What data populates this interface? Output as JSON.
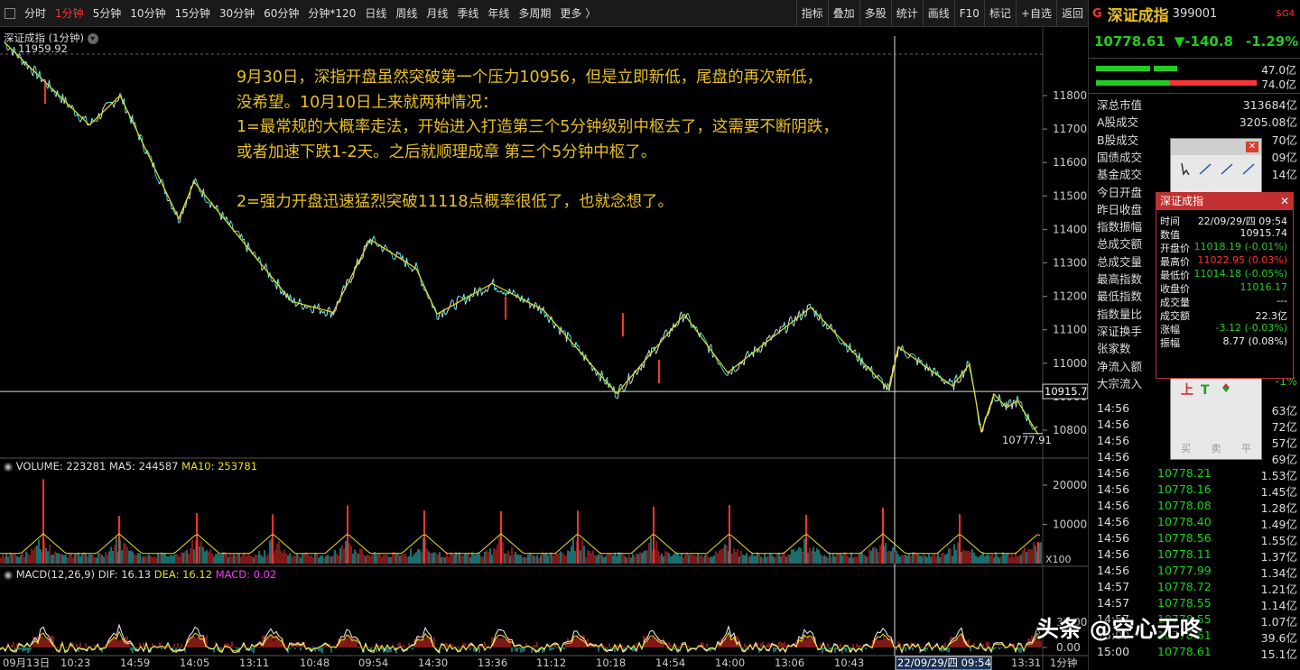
{
  "toolbar": {
    "left": [
      "分时",
      "1分钟",
      "5分钟",
      "10分钟",
      "15分钟",
      "30分钟",
      "60分钟",
      "分钟*120",
      "日线",
      "周线",
      "月线",
      "季线",
      "年线",
      "多周期",
      "更多 〉"
    ],
    "active_index": 1,
    "right": [
      "指标",
      "叠加",
      "多股",
      "统计",
      "画线",
      "F10",
      "标记",
      "+自选",
      "返回"
    ]
  },
  "chart": {
    "title": "深证成指 (1分钟)",
    "high_label": "11959.92",
    "low_label": "10777.91",
    "cursor_value": "10915.7",
    "price_ticks": [
      "11800",
      "11700",
      "11600",
      "11500",
      "11400",
      "11300",
      "11200",
      "11100",
      "11000",
      "10900",
      "10800"
    ],
    "annotation": "9月30日，深指开盘虽然突破第一个压力10956，但是立即新低，尾盘的再次新低，\n没希望。10月10日上来就两种情况：\n1=最常规的大概率走法，开始进入打造第三个5分钟级别中枢去了，这需要不断阴跌，\n或者加速下跌1-2天。之后就顺理成章 第三个5分钟中枢了。\n\n2=强力开盘迅速猛烈突破11118点概率很低了，也就念想了。",
    "volume_label": "VOLUME: 223281",
    "ma5_label": "MA5: 244587",
    "ma10_label": "MA10: 253781",
    "volume_ticks": [
      "20000",
      "10000"
    ],
    "volume_unit": "X100",
    "macd_label": "MACD(12,26,9)",
    "dif_label": "DIF: 16.13",
    "dea_label": "DEA: 16.12",
    "macd_value_label": "MACD: 0.02",
    "macd_ticks": [
      "30.00",
      "0.00"
    ],
    "time_labels": [
      "09月13日",
      "10:23",
      "14:59",
      "14:05",
      "13:11",
      "10:48",
      "09:54",
      "14:30",
      "13:36",
      "11:12",
      "10:18",
      "14:54",
      "14:00",
      "13:06",
      "10:43"
    ],
    "cursor_time": "22/09/29/四 09:54",
    "last_time": "13:31",
    "period_label": "1分钟"
  },
  "quote": {
    "prefix": "G",
    "name": "深证成指",
    "code": "399001",
    "badge": "$G4",
    "price": "10778.61",
    "change": "▼-140.8",
    "change_pct": "-1.29%",
    "bar_up": "47.0亿",
    "bar_down": "74.0亿",
    "rows": [
      {
        "k": "深总市值",
        "v": "313684亿"
      },
      {
        "k": "A股成交",
        "v": "3205.08亿"
      },
      {
        "k": "B股成交",
        "v": "70亿"
      },
      {
        "k": "国债成交",
        "v": "09亿"
      },
      {
        "k": "基金成交",
        "v": "14亿"
      },
      {
        "k": "今日开盘",
        "v": ""
      },
      {
        "k": "昨日收盘",
        "v": ""
      },
      {
        "k": "指数振幅",
        "v": ""
      },
      {
        "k": "总成交额",
        "v": ""
      },
      {
        "k": "总成交量",
        "v": ""
      },
      {
        "k": "最高指数",
        "v": ""
      },
      {
        "k": "最低指数",
        "v": ""
      },
      {
        "k": "指数量比",
        "v": ""
      },
      {
        "k": "深证换手",
        "v": ""
      },
      {
        "k": "张家数",
        "v": ""
      },
      {
        "k": "净流入额",
        "v": ""
      },
      {
        "k": "大宗流入",
        "v": "-1%"
      }
    ],
    "ticks": [
      {
        "t": "14:56",
        "p": "",
        "s": "63亿"
      },
      {
        "t": "14:56",
        "p": "",
        "s": "72亿"
      },
      {
        "t": "14:56",
        "p": "",
        "s": "57亿"
      },
      {
        "t": "14:56",
        "p": "",
        "s": "69亿"
      },
      {
        "t": "14:56",
        "p": "10778.21",
        "s": "1.53亿"
      },
      {
        "t": "14:56",
        "p": "10778.16",
        "s": "1.45亿"
      },
      {
        "t": "14:56",
        "p": "10778.08",
        "s": "1.28亿"
      },
      {
        "t": "14:56",
        "p": "10778.40",
        "s": "1.49亿"
      },
      {
        "t": "14:56",
        "p": "10778.56",
        "s": "1.55亿"
      },
      {
        "t": "14:56",
        "p": "10778.11",
        "s": "1.37亿"
      },
      {
        "t": "14:56",
        "p": "10777.99",
        "s": "1.34亿"
      },
      {
        "t": "14:57",
        "p": "10778.72",
        "s": "1.21亿"
      },
      {
        "t": "14:57",
        "p": "10778.55",
        "s": "1.14亿"
      },
      {
        "t": "14:57",
        "p": "10778.55",
        "s": "1.07亿"
      },
      {
        "t": "15:00",
        "p": "10778.61",
        "s": "39.6亿"
      },
      {
        "t": "15:00",
        "p": "10778.61",
        "s": "15.1亿"
      }
    ]
  },
  "popup": {
    "title": "深证成指",
    "rows": [
      {
        "k": "时间",
        "v": "22/09/29/四  09:54",
        "c": "#eeeeee"
      },
      {
        "k": "数值",
        "v": "10915.74",
        "c": "#eeeeee"
      },
      {
        "k": "开盘价",
        "v": "11018.19 (-0.01%)",
        "c": "#22cc22"
      },
      {
        "k": "最高价",
        "v": "11022.95 (0.03%)",
        "c": "#ff3333"
      },
      {
        "k": "最低价",
        "v": "11014.18 (-0.05%)",
        "c": "#22cc22"
      },
      {
        "k": "收盘价",
        "v": "11016.17",
        "c": "#22cc22"
      },
      {
        "k": "成交量",
        "v": "---",
        "c": "#eeeeee"
      },
      {
        "k": "成交额",
        "v": "22.3亿",
        "c": "#eeeeee"
      },
      {
        "k": "涨幅",
        "v": "-3.12 (-0.03%)",
        "c": "#22cc22"
      },
      {
        "k": "振幅",
        "v": "8.77 (0.08%)",
        "c": "#eeeeee"
      }
    ]
  },
  "toolpanel": {
    "bottom_labels": [
      "买",
      "卖",
      "平"
    ]
  },
  "watermark": "头条 @空心无咚",
  "colors": {
    "up": "#ff3333",
    "down": "#22cc22",
    "line": "#e8e020",
    "cyan": "#33dddd",
    "annotation": "#e8c020"
  }
}
